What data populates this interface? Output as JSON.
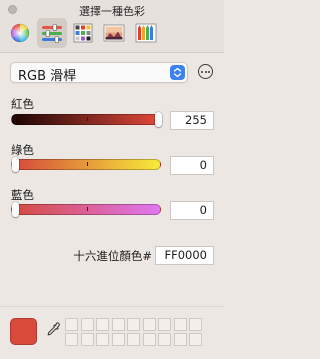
{
  "window": {
    "title": "選擇一種色彩"
  },
  "toolbar": {
    "tabs": [
      {
        "name": "color-wheel",
        "active": false
      },
      {
        "name": "sliders",
        "active": true
      },
      {
        "name": "palettes",
        "active": false
      },
      {
        "name": "image-palettes",
        "active": false
      },
      {
        "name": "pencils",
        "active": false
      }
    ]
  },
  "mode": {
    "selected": "RGB 滑桿"
  },
  "sliders": {
    "red": {
      "label": "紅色",
      "value": "255",
      "fraction": 1.0
    },
    "green": {
      "label": "綠色",
      "value": "0",
      "fraction": 0.0
    },
    "blue": {
      "label": "藍色",
      "value": "0",
      "fraction": 0.0
    }
  },
  "hex": {
    "label": "十六進位顏色#",
    "value": "FF0000"
  },
  "current_color": "#d94a3d",
  "colors": {
    "accent": "#3d82f0",
    "red_track_start": "#1a0504",
    "red_track_end": "#e2483a",
    "green_track_start": "#d5473b",
    "green_track_end": "#f7eb3a",
    "blue_track_start": "#d44a3c",
    "blue_track_end": "#e177f2"
  },
  "swatch_wells": {
    "rows": 2,
    "columns": 9
  }
}
